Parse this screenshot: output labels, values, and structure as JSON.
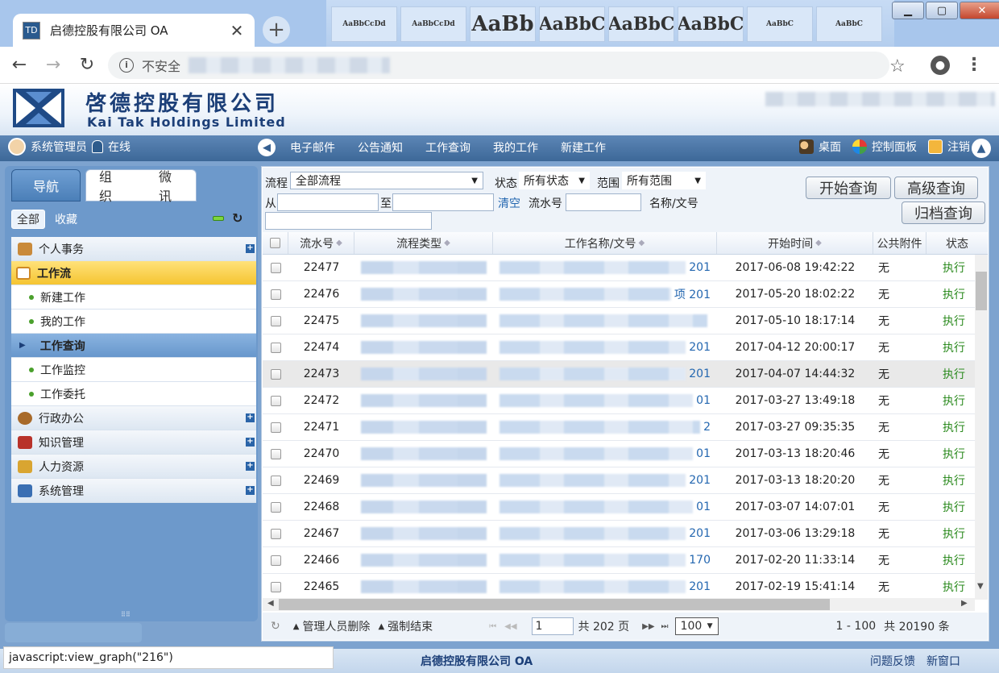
{
  "browser": {
    "tab_title": "启德控股有限公司 OA",
    "tab_favicon": "TD",
    "security_label": "不安全",
    "ribbon_preview": [
      "AaBbCcDd",
      "AaBbCcDd",
      "AaBb",
      "AaBbC",
      "AaBbC",
      "AaBbC",
      "AaBbC",
      "AaBbC"
    ]
  },
  "header": {
    "company_cn": "啓德控股有限公司",
    "company_en": "Kai Tak Holdings Limited"
  },
  "menubar": {
    "user": "系统管理员",
    "status": "在线",
    "items": [
      "电子邮件",
      "公告通知",
      "工作查询",
      "我的工作",
      "新建工作"
    ],
    "right": [
      "桌面",
      "控制面板",
      "注销"
    ]
  },
  "left": {
    "tabs": [
      "导航",
      "组织",
      "微讯"
    ],
    "filter_all": "全部",
    "filter_fav": "收藏",
    "nav": [
      {
        "label": "个人事务",
        "type": "cat",
        "color": "#c98a3a"
      },
      {
        "label": "工作流",
        "type": "active",
        "color": "#d08a25"
      },
      {
        "label": "新建工作",
        "type": "sub"
      },
      {
        "label": "我的工作",
        "type": "sub"
      },
      {
        "label": "工作查询",
        "type": "sel"
      },
      {
        "label": "工作监控",
        "type": "sub"
      },
      {
        "label": "工作委托",
        "type": "sub"
      },
      {
        "label": "行政办公",
        "type": "cat",
        "color": "#a86a2a"
      },
      {
        "label": "知识管理",
        "type": "cat",
        "color": "#b8322a"
      },
      {
        "label": "人力资源",
        "type": "cat",
        "color": "#d9a531"
      },
      {
        "label": "系统管理",
        "type": "cat",
        "color": "#3a6fb3"
      }
    ]
  },
  "query": {
    "flow_label": "流程",
    "flow_value": "全部流程",
    "status_label": "状态",
    "status_value": "所有状态",
    "scope_label": "范围",
    "scope_value": "所有范围",
    "from_label": "从",
    "to_label": "至",
    "clear_label": "清空",
    "serial_label": "流水号",
    "name_label": "名称/文号",
    "btn_start": "开始查询",
    "btn_advanced": "高级查询",
    "btn_archive": "归档查询"
  },
  "table": {
    "headers": [
      "流水号",
      "流程类型",
      "工作名称/文号",
      "开始时间",
      "公共附件",
      "状态"
    ],
    "rows": [
      {
        "id": "22477",
        "name_tail": "201",
        "time": "2017-06-08 19:42:22",
        "attach": "无",
        "status": "执行"
      },
      {
        "id": "22476",
        "name_tail": "项 201",
        "time": "2017-05-20 18:02:22",
        "attach": "无",
        "status": "执行"
      },
      {
        "id": "22475",
        "name_tail": "",
        "time": "2017-05-10 18:17:14",
        "attach": "无",
        "status": "执行"
      },
      {
        "id": "22474",
        "name_tail": "201",
        "time": "2017-04-12 20:00:17",
        "attach": "无",
        "status": "执行"
      },
      {
        "id": "22473",
        "name_tail": "201",
        "time": "2017-04-07 14:44:32",
        "attach": "无",
        "status": "执行"
      },
      {
        "id": "22472",
        "name_tail": "01",
        "time": "2017-03-27 13:49:18",
        "attach": "无",
        "status": "执行"
      },
      {
        "id": "22471",
        "name_tail": "2",
        "time": "2017-03-27 09:35:35",
        "attach": "无",
        "status": "执行"
      },
      {
        "id": "22470",
        "name_tail": "01",
        "time": "2017-03-13 18:20:46",
        "attach": "无",
        "status": "执行"
      },
      {
        "id": "22469",
        "name_tail": "201",
        "time": "2017-03-13 18:20:20",
        "attach": "无",
        "status": "执行"
      },
      {
        "id": "22468",
        "name_tail": "01",
        "time": "2017-03-07 14:07:01",
        "attach": "无",
        "status": "执行"
      },
      {
        "id": "22467",
        "name_tail": "201",
        "time": "2017-03-06 13:29:18",
        "attach": "无",
        "status": "执行"
      },
      {
        "id": "22466",
        "name_tail": "170",
        "time": "2017-02-20 11:33:14",
        "attach": "无",
        "status": "执行"
      },
      {
        "id": "22465",
        "name_tail": "201",
        "time": "2017-02-19 15:41:14",
        "attach": "无",
        "status": "执行"
      }
    ]
  },
  "pager": {
    "admin_delete": "管理人员删除",
    "force_end": "强制结束",
    "page_value": "1",
    "total_pages": "共 202 页",
    "page_size": "100",
    "range": "1 - 100",
    "total": "共 20190 条"
  },
  "status": {
    "link": "javascript:view_graph(\"216\")",
    "center": "启德控股有限公司 OA",
    "feedback": "问题反馈",
    "new_window": "新窗口"
  }
}
